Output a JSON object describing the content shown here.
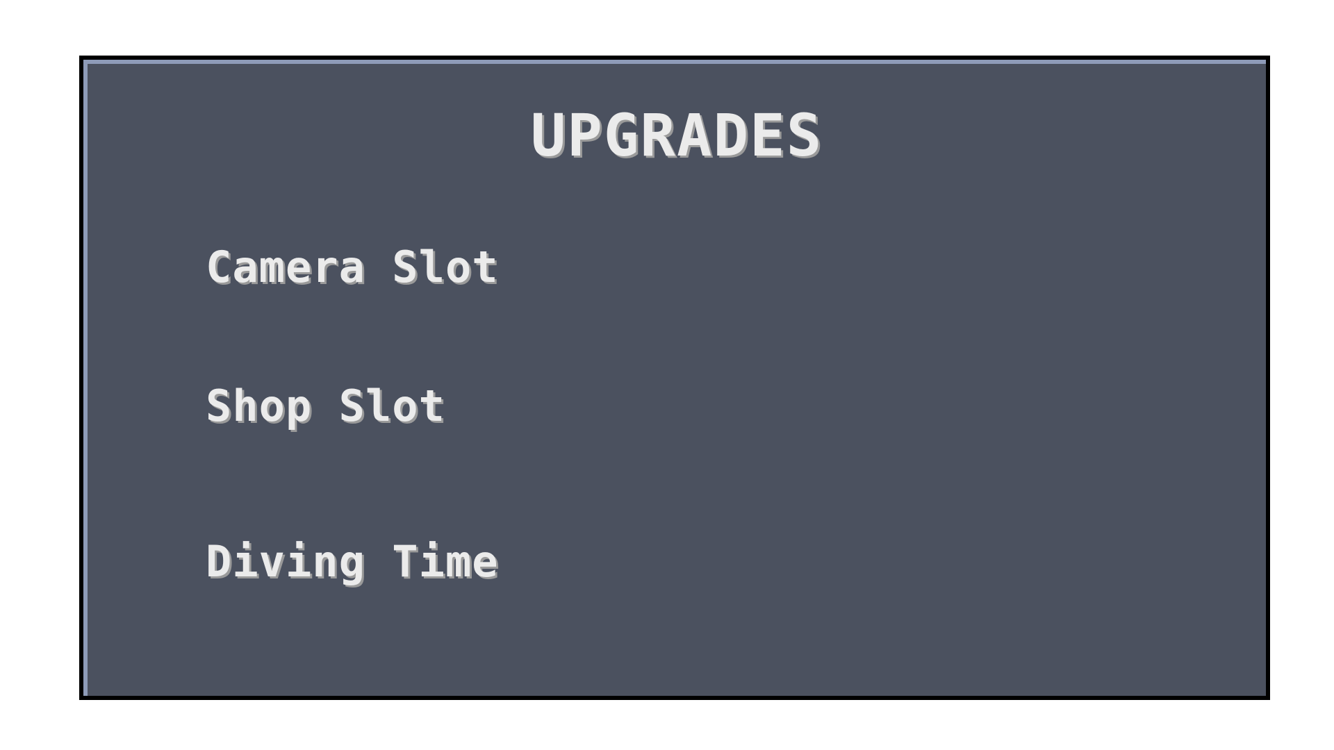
{
  "panel": {
    "title": "UPGRADES",
    "items": [
      {
        "label": "Camera Slot"
      },
      {
        "label": "Shop Slot"
      },
      {
        "label": "Diving Time"
      }
    ]
  },
  "colors": {
    "panel_background": "#4b515f",
    "panel_highlight": "#8e9bb8",
    "panel_border": "#000000",
    "text": "#ebebeb"
  }
}
